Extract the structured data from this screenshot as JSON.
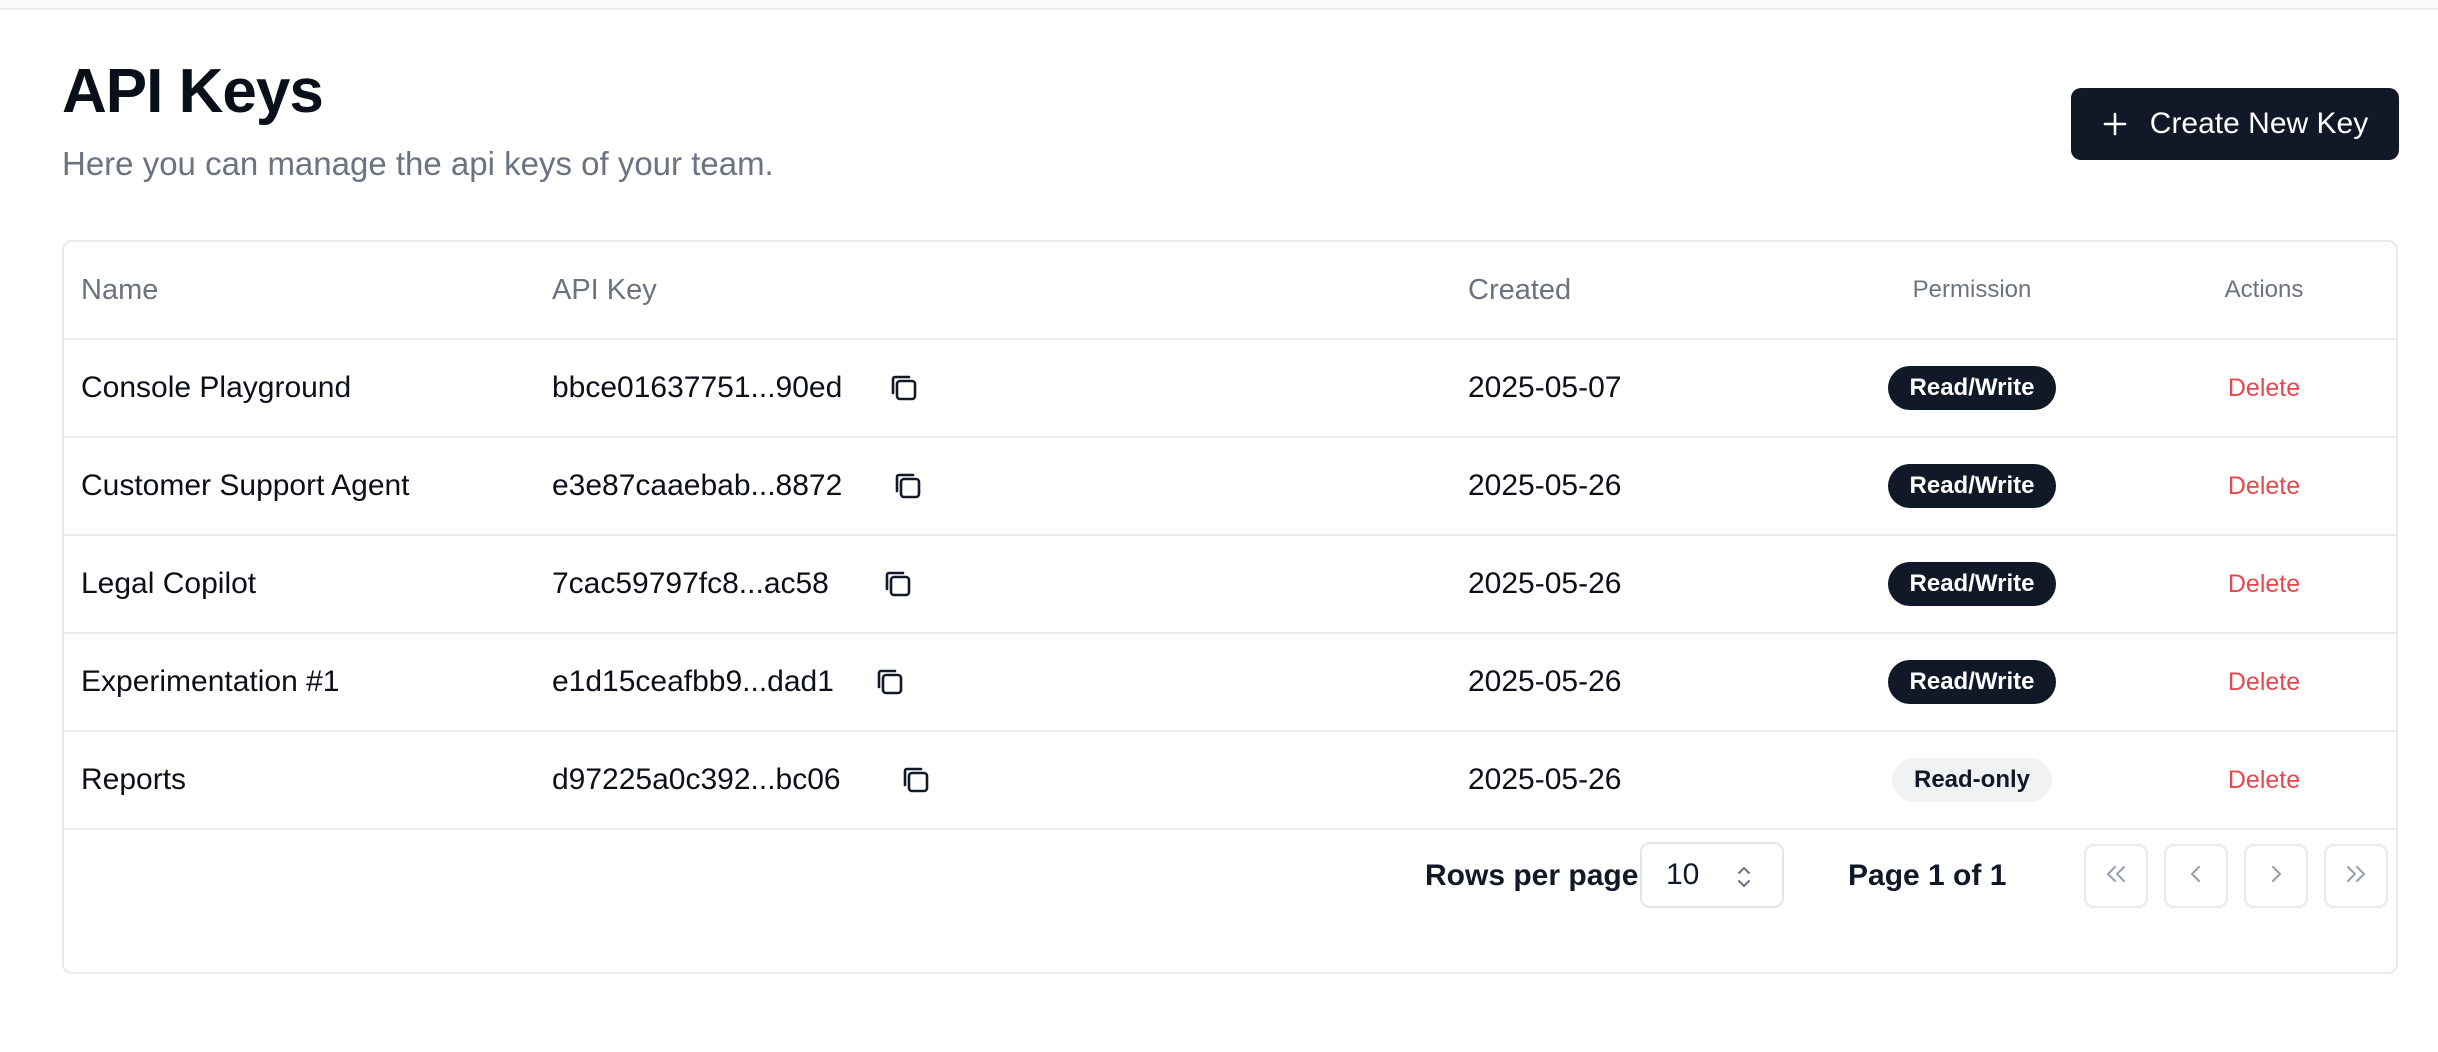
{
  "header": {
    "title": "API Keys",
    "subtitle": "Here you can manage the api keys of your team.",
    "create_button_label": "Create New Key"
  },
  "table": {
    "columns": {
      "name": "Name",
      "api_key": "API Key",
      "created": "Created",
      "permission": "Permission",
      "actions": "Actions"
    },
    "rows": [
      {
        "name": "Console Playground",
        "api_key": "bbce01637751...90ed",
        "created": "2025-05-07",
        "permission": "Read/Write",
        "action": "Delete"
      },
      {
        "name": "Customer Support Agent",
        "api_key": "e3e87caaebab...8872",
        "created": "2025-05-26",
        "permission": "Read/Write",
        "action": "Delete"
      },
      {
        "name": "Legal Copilot",
        "api_key": "7cac59797fc8...ac58",
        "created": "2025-05-26",
        "permission": "Read/Write",
        "action": "Delete"
      },
      {
        "name": "Experimentation #1",
        "api_key": "e1d15ceafbb9...dad1",
        "created": "2025-05-26",
        "permission": "Read/Write",
        "action": "Delete"
      },
      {
        "name": "Reports",
        "api_key": "d97225a0c392...bc06",
        "created": "2025-05-26",
        "permission": "Read-only",
        "action": "Delete"
      }
    ]
  },
  "pagination": {
    "rows_per_page_label": "Rows per page",
    "rows_per_page_value": "10",
    "page_label": "Page 1 of 1"
  },
  "icons": {
    "create": "plus-icon",
    "copy": "copy-icon",
    "select": "chevron-up-down-icon",
    "first": "chevrons-left-icon",
    "prev": "chevron-left-icon",
    "next": "chevron-right-icon",
    "last": "chevrons-right-icon"
  },
  "colors": {
    "primary": "#111827",
    "danger": "#e5484d",
    "muted": "#6b7280",
    "badge_light": "#f1f2f4"
  }
}
